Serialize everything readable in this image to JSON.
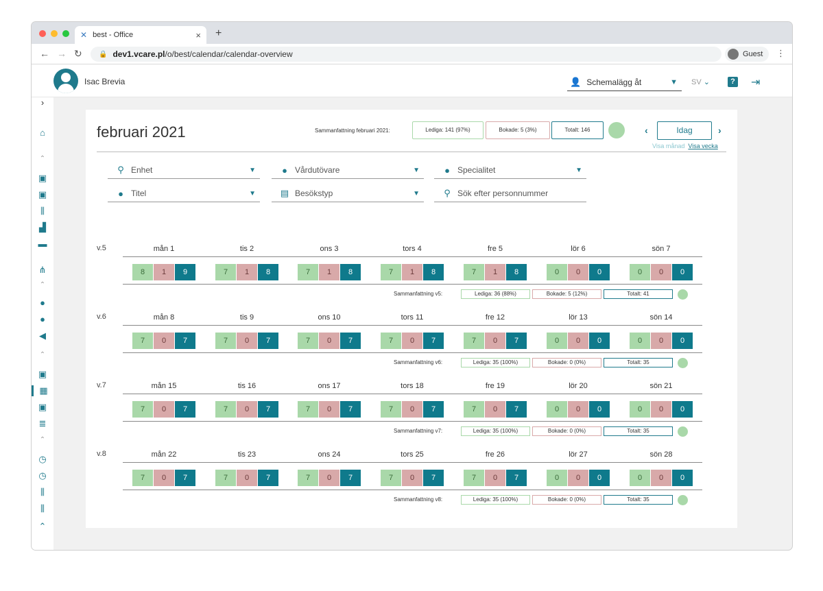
{
  "browser": {
    "tab_title": "best - Office",
    "url_domain": "dev1.vcare.pl",
    "url_path": "/o/best/calendar/calendar-overview",
    "profile": "Guest"
  },
  "header": {
    "user_name": "Isac Brevia",
    "schedule_placeholder": "Schemalägg åt",
    "language": "SV"
  },
  "calendar": {
    "title": "februari 2021",
    "summary_label": "Sammanfattning februari 2021:",
    "free": "Lediga: 141 (97%)",
    "booked": "Bokade: 5 (3%)",
    "total": "Totalt: 146",
    "today_button": "Idag",
    "view_month": "Visa månad",
    "view_week": "Visa vecka"
  },
  "filters": [
    {
      "label": "Enhet",
      "icon": "location-icon"
    },
    {
      "label": "Vårdutövare",
      "icon": "caregiver-icon"
    },
    {
      "label": "Specialitet",
      "icon": "specialty-icon"
    },
    {
      "label": "Titel",
      "icon": "title-icon"
    },
    {
      "label": "Besökstyp",
      "icon": "visit-type-icon"
    },
    {
      "label": "Sök efter personnummer",
      "icon": "search-icon"
    }
  ],
  "weeks": [
    {
      "label": "v.5",
      "days": [
        {
          "name": "mån 1",
          "values": [
            "8",
            "1",
            "9"
          ]
        },
        {
          "name": "tis 2",
          "values": [
            "7",
            "1",
            "8"
          ]
        },
        {
          "name": "ons 3",
          "values": [
            "7",
            "1",
            "8"
          ]
        },
        {
          "name": "tors 4",
          "values": [
            "7",
            "1",
            "8"
          ]
        },
        {
          "name": "fre 5",
          "values": [
            "7",
            "1",
            "8"
          ]
        },
        {
          "name": "lör 6",
          "values": [
            "0",
            "0",
            "0"
          ]
        },
        {
          "name": "sön 7",
          "values": [
            "0",
            "0",
            "0"
          ]
        }
      ],
      "summary_label": "Sammanfattning v5:",
      "free": "Lediga: 36 (88%)",
      "booked": "Bokade: 5 (12%)",
      "total": "Totalt: 41"
    },
    {
      "label": "v.6",
      "days": [
        {
          "name": "mån 8",
          "values": [
            "7",
            "0",
            "7"
          ]
        },
        {
          "name": "tis 9",
          "values": [
            "7",
            "0",
            "7"
          ]
        },
        {
          "name": "ons 10",
          "values": [
            "7",
            "0",
            "7"
          ]
        },
        {
          "name": "tors 11",
          "values": [
            "7",
            "0",
            "7"
          ]
        },
        {
          "name": "fre 12",
          "values": [
            "7",
            "0",
            "7"
          ]
        },
        {
          "name": "lör 13",
          "values": [
            "0",
            "0",
            "0"
          ]
        },
        {
          "name": "sön 14",
          "values": [
            "0",
            "0",
            "0"
          ]
        }
      ],
      "summary_label": "Sammanfattning v6:",
      "free": "Lediga: 35 (100%)",
      "booked": "Bokade: 0 (0%)",
      "total": "Totalt: 35"
    },
    {
      "label": "v.7",
      "days": [
        {
          "name": "mån 15",
          "values": [
            "7",
            "0",
            "7"
          ]
        },
        {
          "name": "tis 16",
          "values": [
            "7",
            "0",
            "7"
          ]
        },
        {
          "name": "ons 17",
          "values": [
            "7",
            "0",
            "7"
          ]
        },
        {
          "name": "tors 18",
          "values": [
            "7",
            "0",
            "7"
          ]
        },
        {
          "name": "fre 19",
          "values": [
            "7",
            "0",
            "7"
          ]
        },
        {
          "name": "lör 20",
          "values": [
            "0",
            "0",
            "0"
          ]
        },
        {
          "name": "sön 21",
          "values": [
            "0",
            "0",
            "0"
          ]
        }
      ],
      "summary_label": "Sammanfattning v7:",
      "free": "Lediga: 35 (100%)",
      "booked": "Bokade: 0 (0%)",
      "total": "Totalt: 35"
    },
    {
      "label": "v.8",
      "days": [
        {
          "name": "mån 22",
          "values": [
            "7",
            "0",
            "7"
          ]
        },
        {
          "name": "tis 23",
          "values": [
            "7",
            "0",
            "7"
          ]
        },
        {
          "name": "ons 24",
          "values": [
            "7",
            "0",
            "7"
          ]
        },
        {
          "name": "tors 25",
          "values": [
            "7",
            "0",
            "7"
          ]
        },
        {
          "name": "fre 26",
          "values": [
            "7",
            "0",
            "7"
          ]
        },
        {
          "name": "lör 27",
          "values": [
            "0",
            "0",
            "0"
          ]
        },
        {
          "name": "sön 28",
          "values": [
            "0",
            "0",
            "0"
          ]
        }
      ],
      "summary_label": "Sammanfattning v8:",
      "free": "Lediga: 35 (100%)",
      "booked": "Bokade: 0 (0%)",
      "total": "Totalt: 35"
    }
  ],
  "colors": {
    "accent": "#1f7a8c",
    "free": "#a9d8a9",
    "booked": "#d8a9a9",
    "total": "#0f7a8c"
  }
}
